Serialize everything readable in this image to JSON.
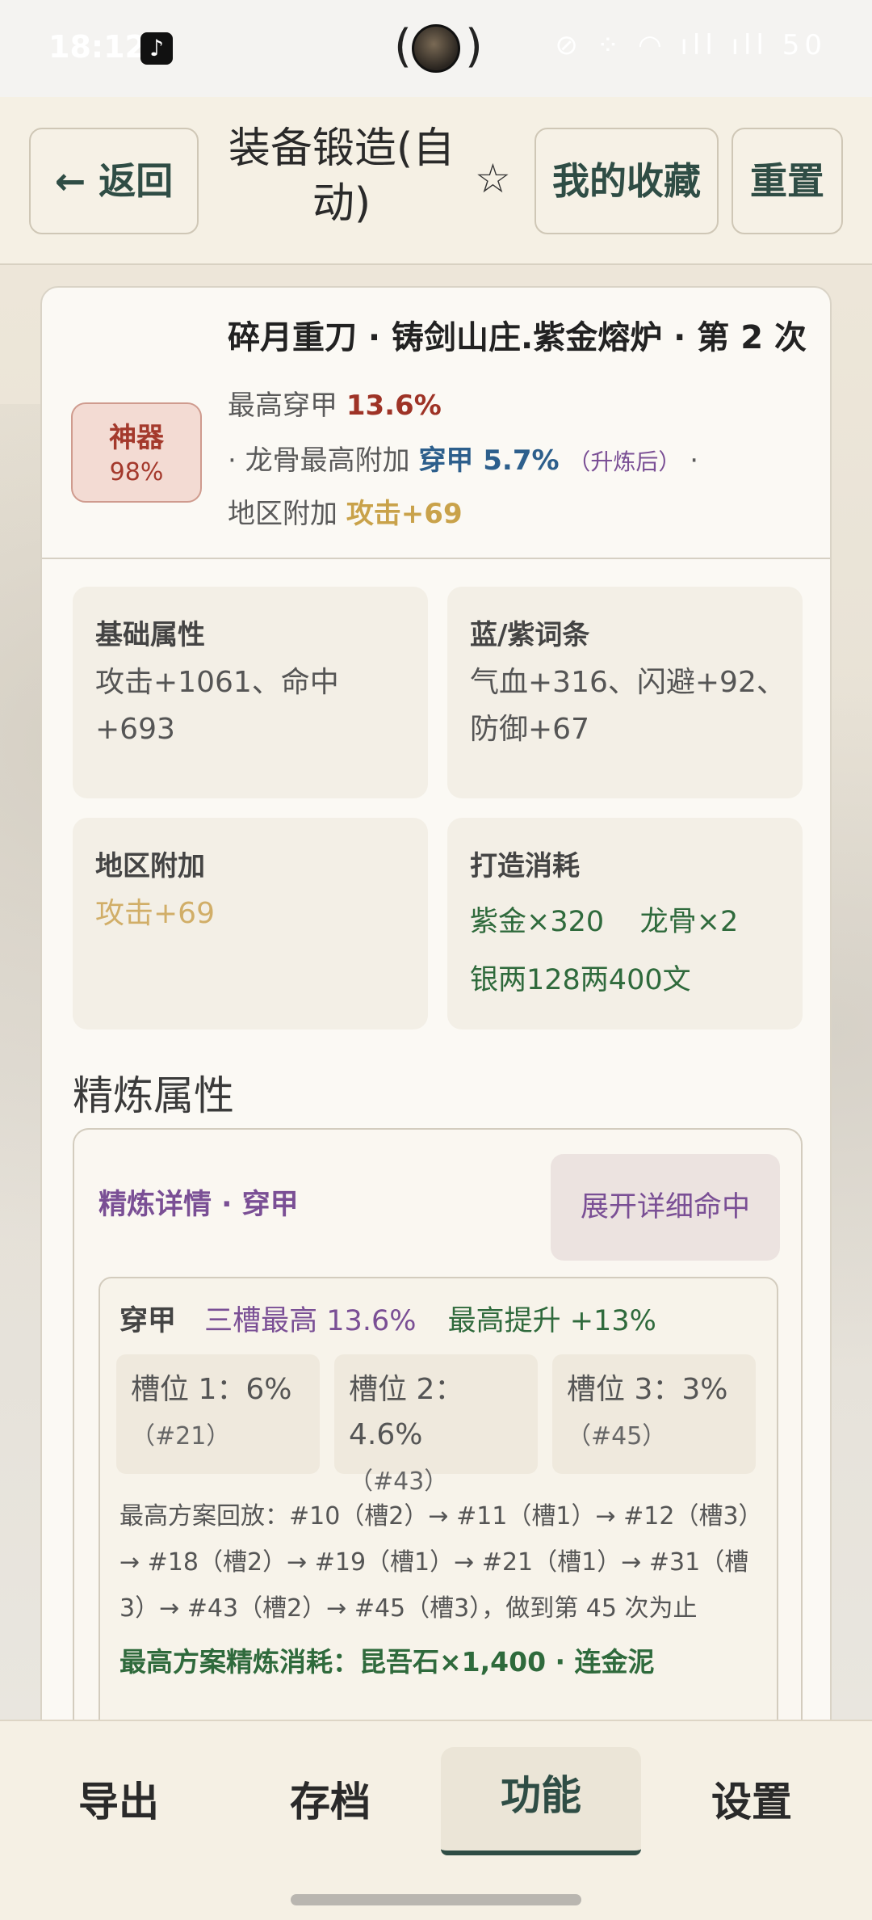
{
  "status_bar": {
    "time": "18:12",
    "app_icon": "tiktok-icon",
    "island_left": "(",
    "island_right": ")",
    "indicators": "⊘ ⁘ ◠ ıll ıll 50"
  },
  "header": {
    "back_icon": "←",
    "back_label": "返回",
    "title": "装备锻造(自动)",
    "star_icon": "☆",
    "favorites_label": "我的收藏",
    "reset_label": "重置"
  },
  "item": {
    "badge_name": "神器",
    "badge_percent": "98%",
    "title": "碎月重刀 · 铸剑山庄.紫金熔炉 · 第 2 次",
    "pen_label": "最高穿甲",
    "pen_value": "13.6%",
    "dragon_prefix": "· 龙骨最高附加",
    "dragon_value": "穿甲 5.7%",
    "dragon_note": "（升炼后）",
    "dragon_suffix": "·",
    "region_label": "地区附加",
    "region_value": "攻击+69"
  },
  "stats": {
    "base_title": "基础属性",
    "base_value": "攻击+1061、命中+693",
    "blue_title": "蓝/紫词条",
    "blue_value": "气血+316、闪避+92、防御+67",
    "region_title": "地区附加",
    "region_value": "攻击+69",
    "cost_title": "打造消耗",
    "cost_line1": "紫金×320    龙骨×2",
    "cost_line2": "银两128两400文"
  },
  "refine": {
    "section_title": "精炼属性",
    "detail_title": "精炼详情 · 穿甲",
    "expand_label": "展开详细命中",
    "attr": "穿甲",
    "three_slot_max": "三槽最高 13.6%",
    "max_gain": "最高提升 +13%",
    "slots": [
      {
        "label": "槽位 1：6%",
        "note": "（#21）"
      },
      {
        "label": "槽位 2：4.6%",
        "note": "（#43）"
      },
      {
        "label": "槽位 3：3%",
        "note": "（#45）"
      }
    ],
    "plan": "最高方案回放：#10（槽2）→ #11（槽1）→ #12（槽3）→ #18（槽2）→ #19（槽1）→ #21（槽1）→ #31（槽3）→ #43（槽2）→ #45（槽3），做到第 45 次为止",
    "cost": "最高方案精炼消耗：昆吾石×1,400 · 连金泥"
  },
  "bottom_nav": {
    "items": [
      "导出",
      "存档",
      "功能",
      "设置"
    ],
    "active": "功能"
  },
  "colors": {
    "accent_green": "#2f4d45",
    "red": "#9e3326",
    "blue": "#2d5f8c",
    "purple": "#7a4f95",
    "gold": "#c9a24a",
    "green_text": "#2f6a3c"
  }
}
